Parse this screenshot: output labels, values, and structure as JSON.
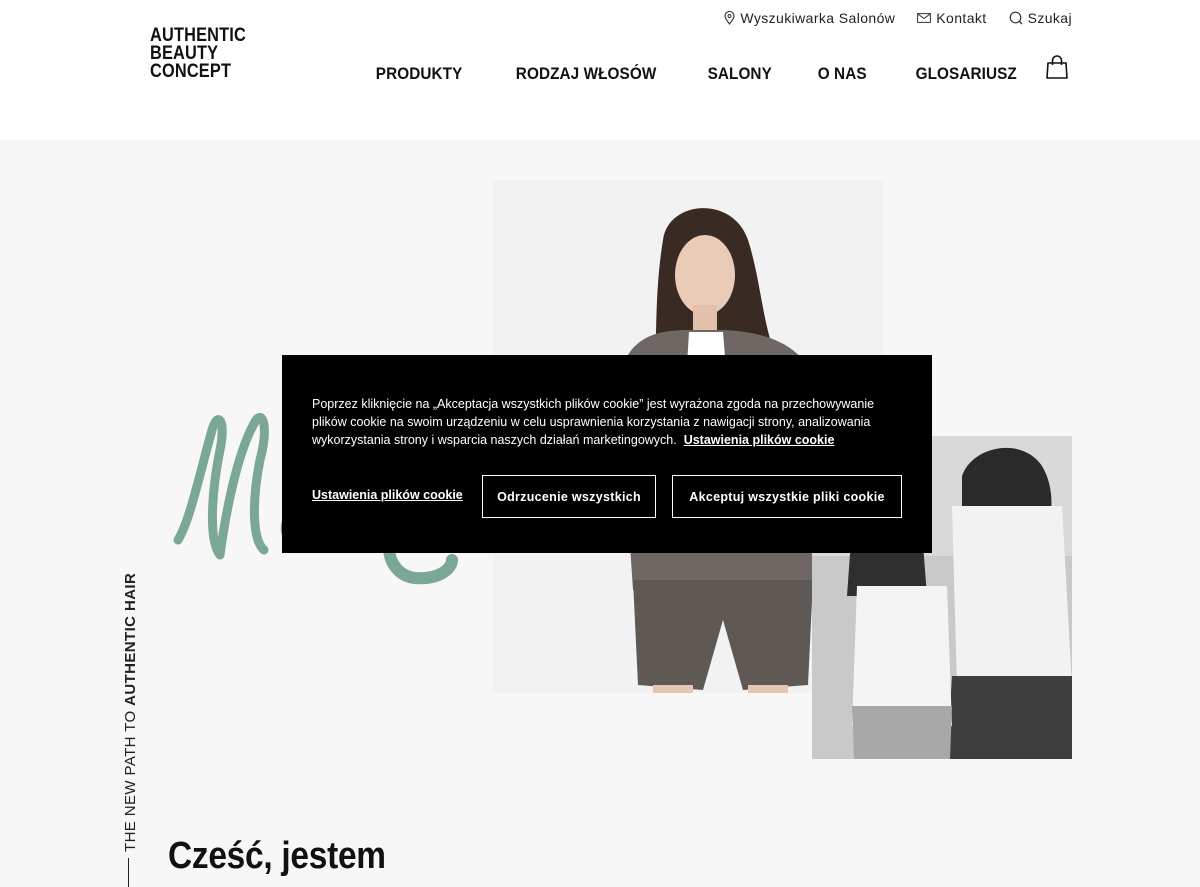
{
  "brand": {
    "logo_lines": [
      "AUTHENTIC",
      "BEAUTY",
      "CONCEPT"
    ]
  },
  "utility_nav": [
    {
      "label": "Wyszukiwarka Salonów",
      "icon": "location-pin-icon"
    },
    {
      "label": "Kontakt",
      "icon": "envelope-icon"
    },
    {
      "label": "Szukaj",
      "icon": "search-icon"
    }
  ],
  "main_nav": [
    "PRODUKTY",
    "RODZAJ WŁOSÓW",
    "SALONY",
    "O NAS",
    "GLOSARIUSZ"
  ],
  "hero": {
    "script_text": "Ma",
    "script_color": "#7ba894",
    "vertical_tag_light": "THE NEW PATH TO ",
    "vertical_tag_bold": "AUTHENTIC HAIR",
    "greeting": "Cześć, jestem"
  },
  "cookie": {
    "text": "Poprzez kliknięcie na „Akceptacja wszystkich plików cookie” jest wyrażona zgoda na przechowywanie plików cookie na swoim urządzeniu w celu usprawnienia korzystania z nawigacji strony, analizowania wykorzystania strony i wsparcia naszych działań marketingowych.",
    "inline_link": "Ustawienia plików cookie",
    "settings_link": "Ustawienia plików cookie",
    "reject_label": "Odrzucenie wszystkich",
    "accept_label": "Akceptuj wszystkie pliki cookie"
  }
}
